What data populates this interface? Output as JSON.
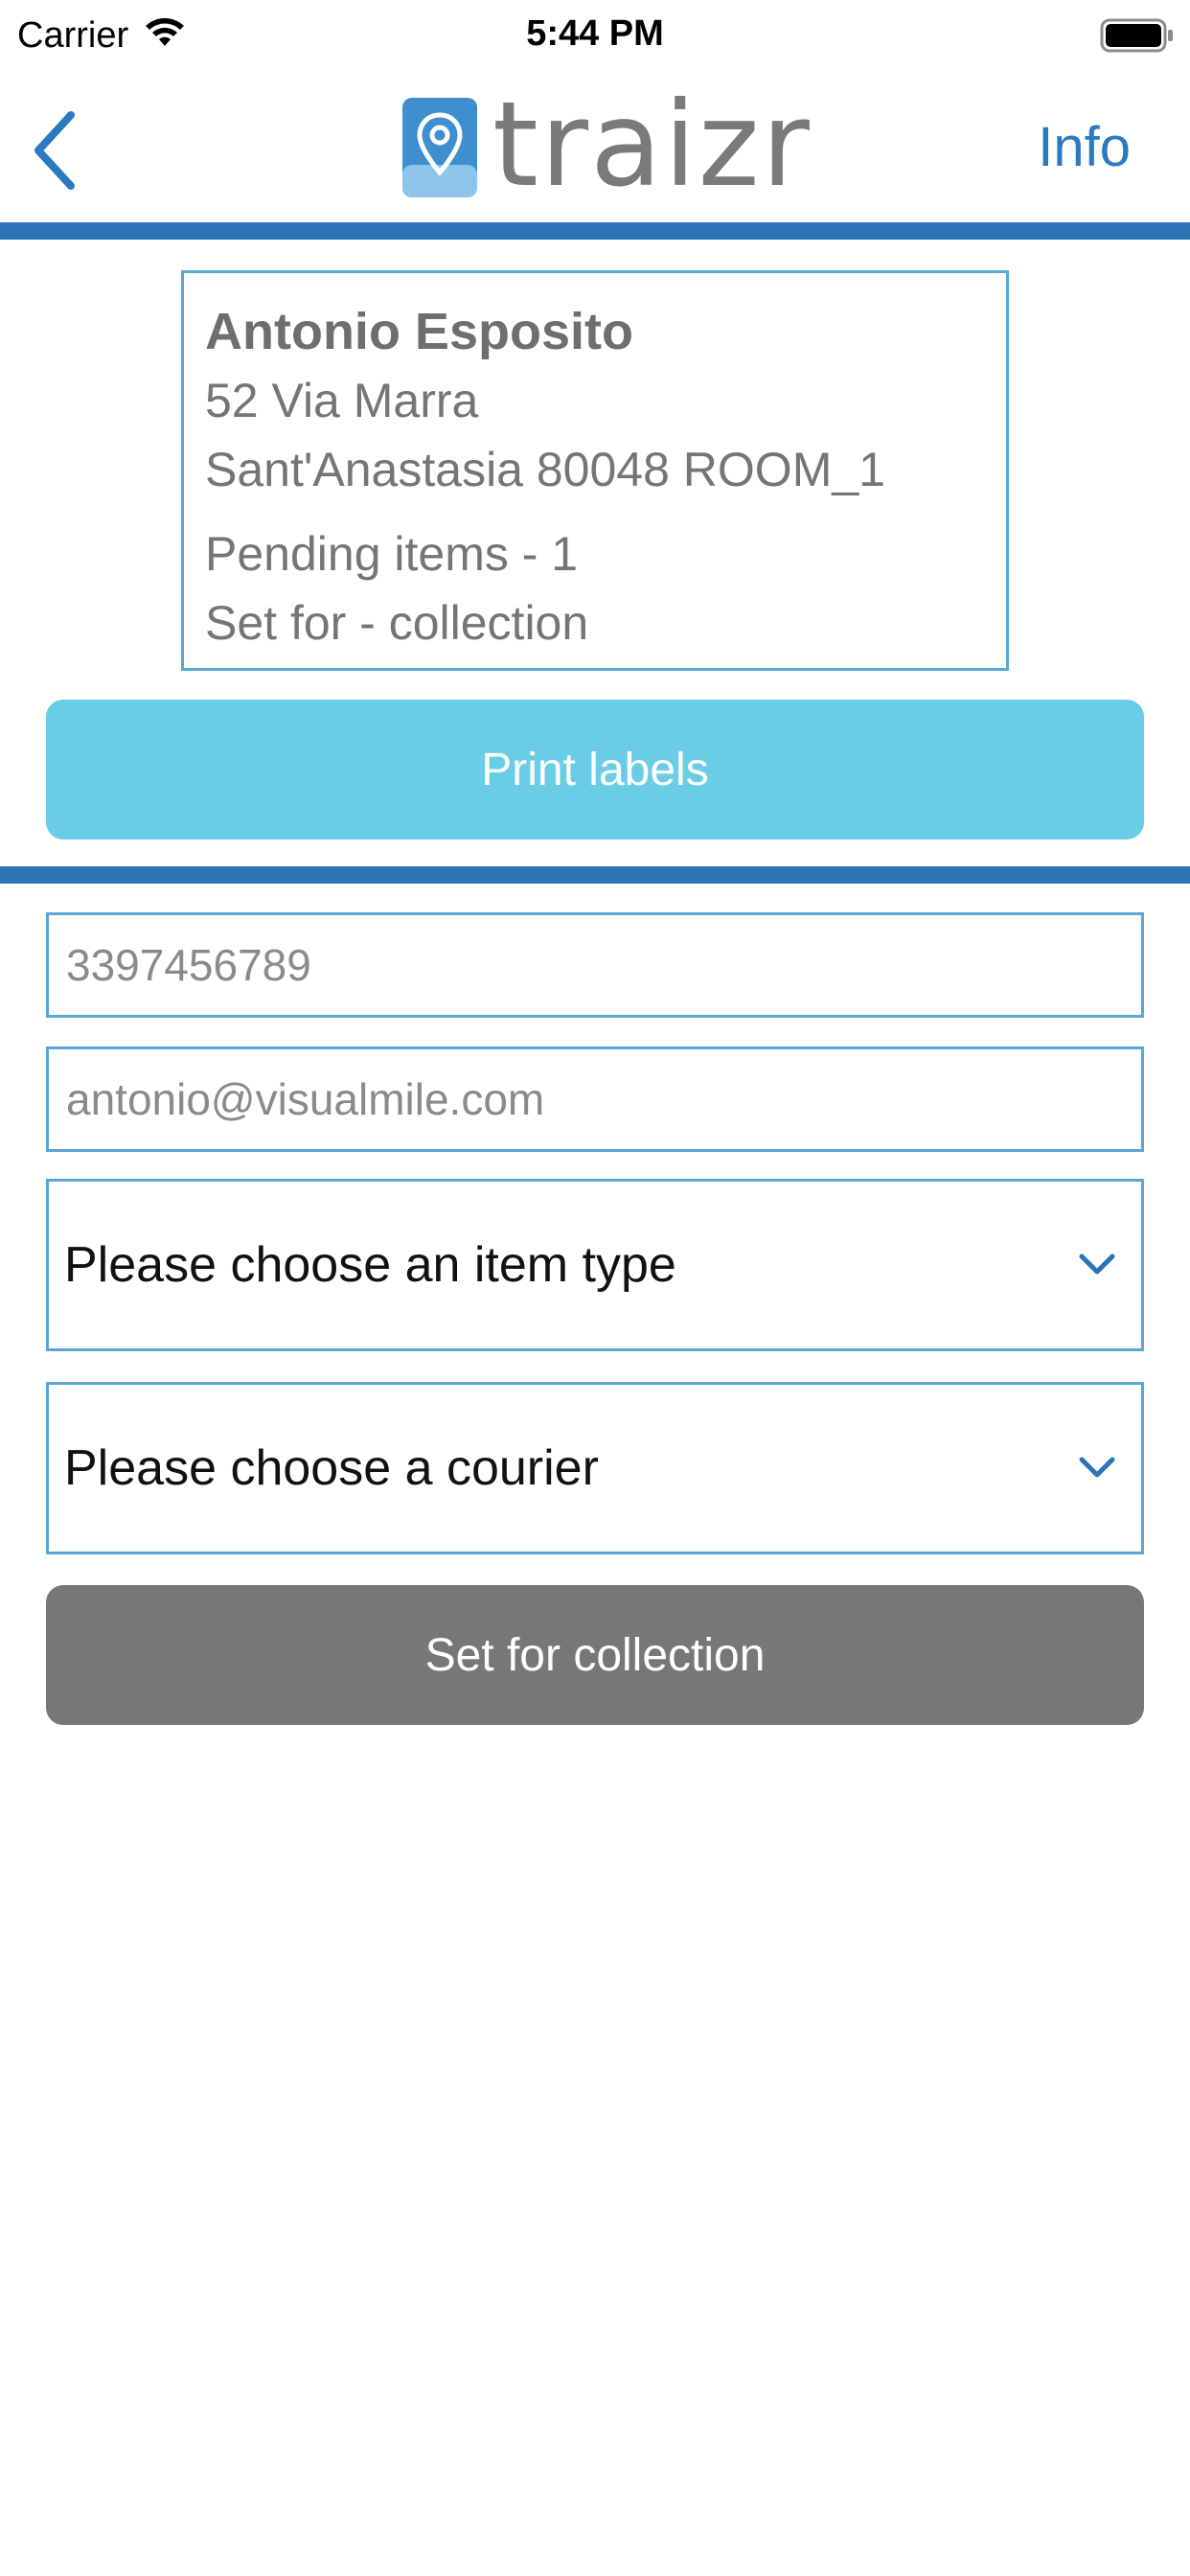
{
  "status_bar": {
    "carrier": "Carrier",
    "time": "5:44 PM"
  },
  "nav": {
    "logo_text": "traizr",
    "info_label": "Info",
    "accent_color": "#2a74b8"
  },
  "customer": {
    "name": "Antonio Esposito",
    "street": "52 Via Marra",
    "city_line": "Sant'Anastasia 80048 ROOM_1",
    "pending": "Pending items - 1",
    "set_for": "Set for - collection"
  },
  "actions": {
    "print_labels": "Print labels",
    "set_for_collection": "Set for collection"
  },
  "form": {
    "phone_value": "3397456789",
    "email_value": "antonio@visualmile.com",
    "item_type_label": "Please choose an item type",
    "courier_label": "Please choose a courier"
  },
  "icons": [
    "wifi-icon",
    "battery-icon",
    "back-chevron-icon",
    "location-pin-icon",
    "chevron-down-icon"
  ]
}
